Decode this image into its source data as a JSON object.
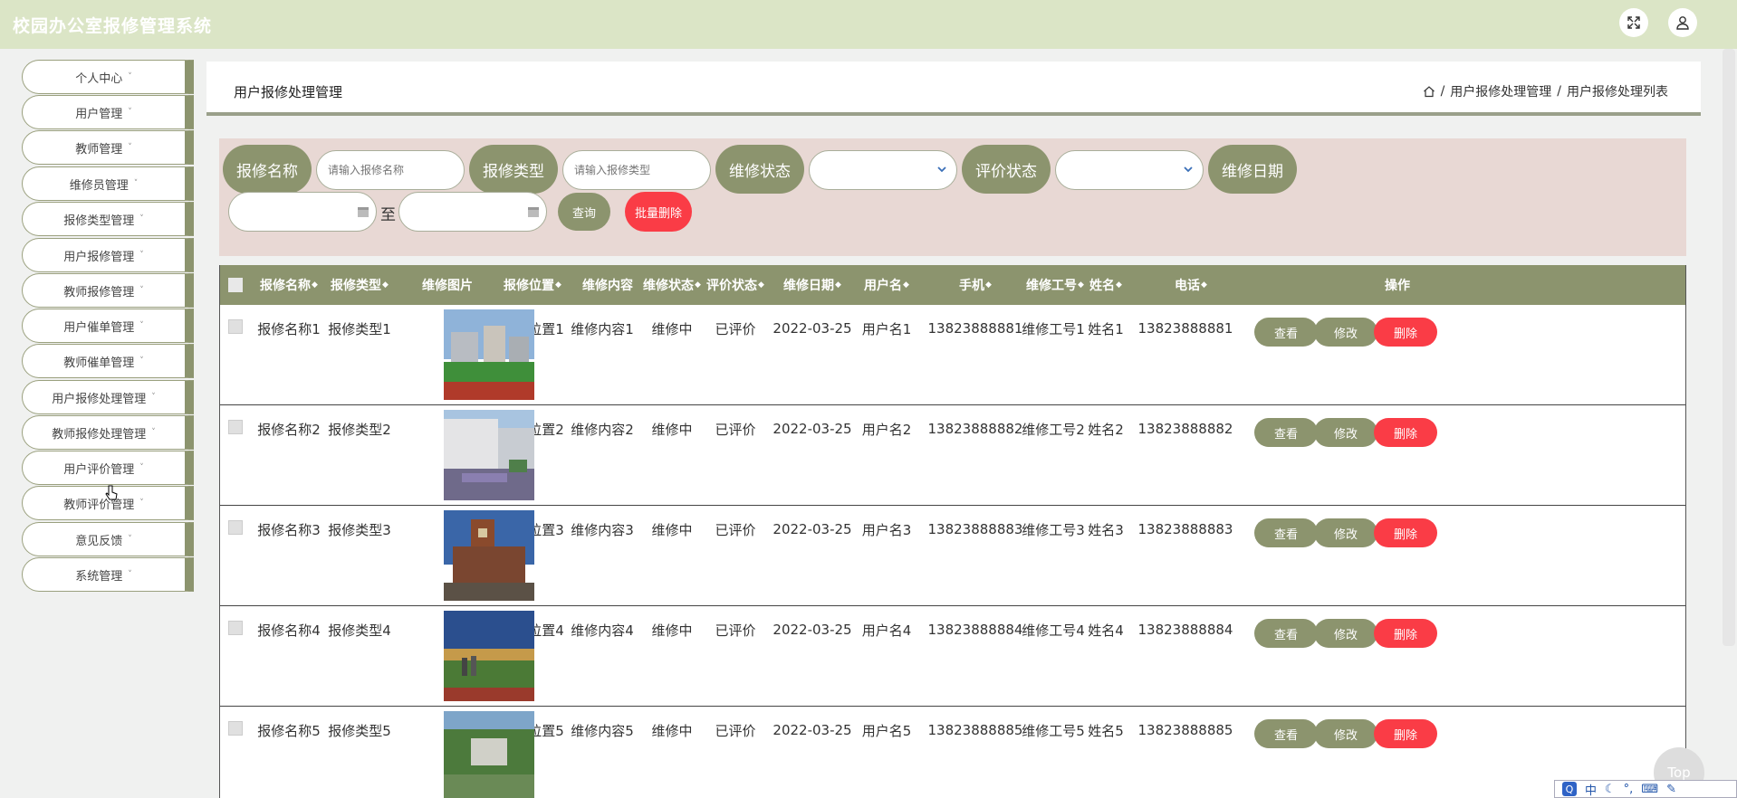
{
  "app": {
    "title": "校园办公室报修管理系统"
  },
  "header": {
    "fullscreen_icon": "expand-icon",
    "user_icon": "user-icon"
  },
  "sidebar": {
    "items": [
      {
        "label": "个人中心"
      },
      {
        "label": "用户管理"
      },
      {
        "label": "教师管理"
      },
      {
        "label": "维修员管理"
      },
      {
        "label": "报修类型管理"
      },
      {
        "label": "用户报修管理"
      },
      {
        "label": "教师报修管理"
      },
      {
        "label": "用户催单管理"
      },
      {
        "label": "教师催单管理"
      },
      {
        "label": "用户报修处理管理"
      },
      {
        "label": "教师报修处理管理"
      },
      {
        "label": "用户评价管理"
      },
      {
        "label": "教师评价管理"
      },
      {
        "label": "意见反馈"
      },
      {
        "label": "系统管理"
      }
    ],
    "caret": "˅"
  },
  "breadcrumb": {
    "page_title": "用户报修处理管理",
    "trail": [
      "用户报修处理管理",
      "用户报修处理列表"
    ],
    "sep": "/"
  },
  "filters": {
    "name_label": "报修名称",
    "name_placeholder": "请输入报修名称",
    "type_label": "报修类型",
    "type_placeholder": "请输入报修类型",
    "status_label": "维修状态",
    "eval_label": "评价状态",
    "date_label": "维修日期",
    "to_label": "至",
    "query_button": "查询",
    "batch_delete_button": "批量删除"
  },
  "table": {
    "columns": [
      "报修名称",
      "报修类型",
      "维修图片",
      "报修位置",
      "维修内容",
      "维修状态",
      "评价状态",
      "维修日期",
      "用户名",
      "手机",
      "维修工号",
      "姓名",
      "电话",
      "操作"
    ],
    "sort_glyph": "◆",
    "actions": {
      "view": "查看",
      "edit": "修改",
      "delete": "删除"
    },
    "rows": [
      {
        "name": "报修名称1",
        "type": "报修类型1",
        "location": "报修位置1",
        "content": "维修内容1",
        "status": "维修中",
        "eval": "已评价",
        "date": "2022-03-25",
        "username": "用户名1",
        "phone": "13823888881",
        "worker_id": "维修工号1",
        "worker_name": "姓名1",
        "tel": "13823888881"
      },
      {
        "name": "报修名称2",
        "type": "报修类型2",
        "location": "报修位置2",
        "content": "维修内容2",
        "status": "维修中",
        "eval": "已评价",
        "date": "2022-03-25",
        "username": "用户名2",
        "phone": "13823888882",
        "worker_id": "维修工号2",
        "worker_name": "姓名2",
        "tel": "13823888882"
      },
      {
        "name": "报修名称3",
        "type": "报修类型3",
        "location": "报修位置3",
        "content": "维修内容3",
        "status": "维修中",
        "eval": "已评价",
        "date": "2022-03-25",
        "username": "用户名3",
        "phone": "13823888883",
        "worker_id": "维修工号3",
        "worker_name": "姓名3",
        "tel": "13823888883"
      },
      {
        "name": "报修名称4",
        "type": "报修类型4",
        "location": "报修位置4",
        "content": "维修内容4",
        "status": "维修中",
        "eval": "已评价",
        "date": "2022-03-25",
        "username": "用户名4",
        "phone": "13823888884",
        "worker_id": "维修工号4",
        "worker_name": "姓名4",
        "tel": "13823888884"
      },
      {
        "name": "报修名称5",
        "type": "报修类型5",
        "location": "报修位置5",
        "content": "维修内容5",
        "status": "维修中",
        "eval": "已评价",
        "date": "2022-03-25",
        "username": "用户名5",
        "phone": "13823888885",
        "worker_id": "维修工号5",
        "worker_name": "姓名5",
        "tel": "13823888885"
      }
    ]
  },
  "back_to_top": "Top",
  "ime": {
    "logo": "Q",
    "mode": "中"
  },
  "colors": {
    "accent": "#8c946e",
    "danger": "#fa3c46",
    "header_bg": "#dbe5c6",
    "filter_bg": "#e8d8d4"
  }
}
